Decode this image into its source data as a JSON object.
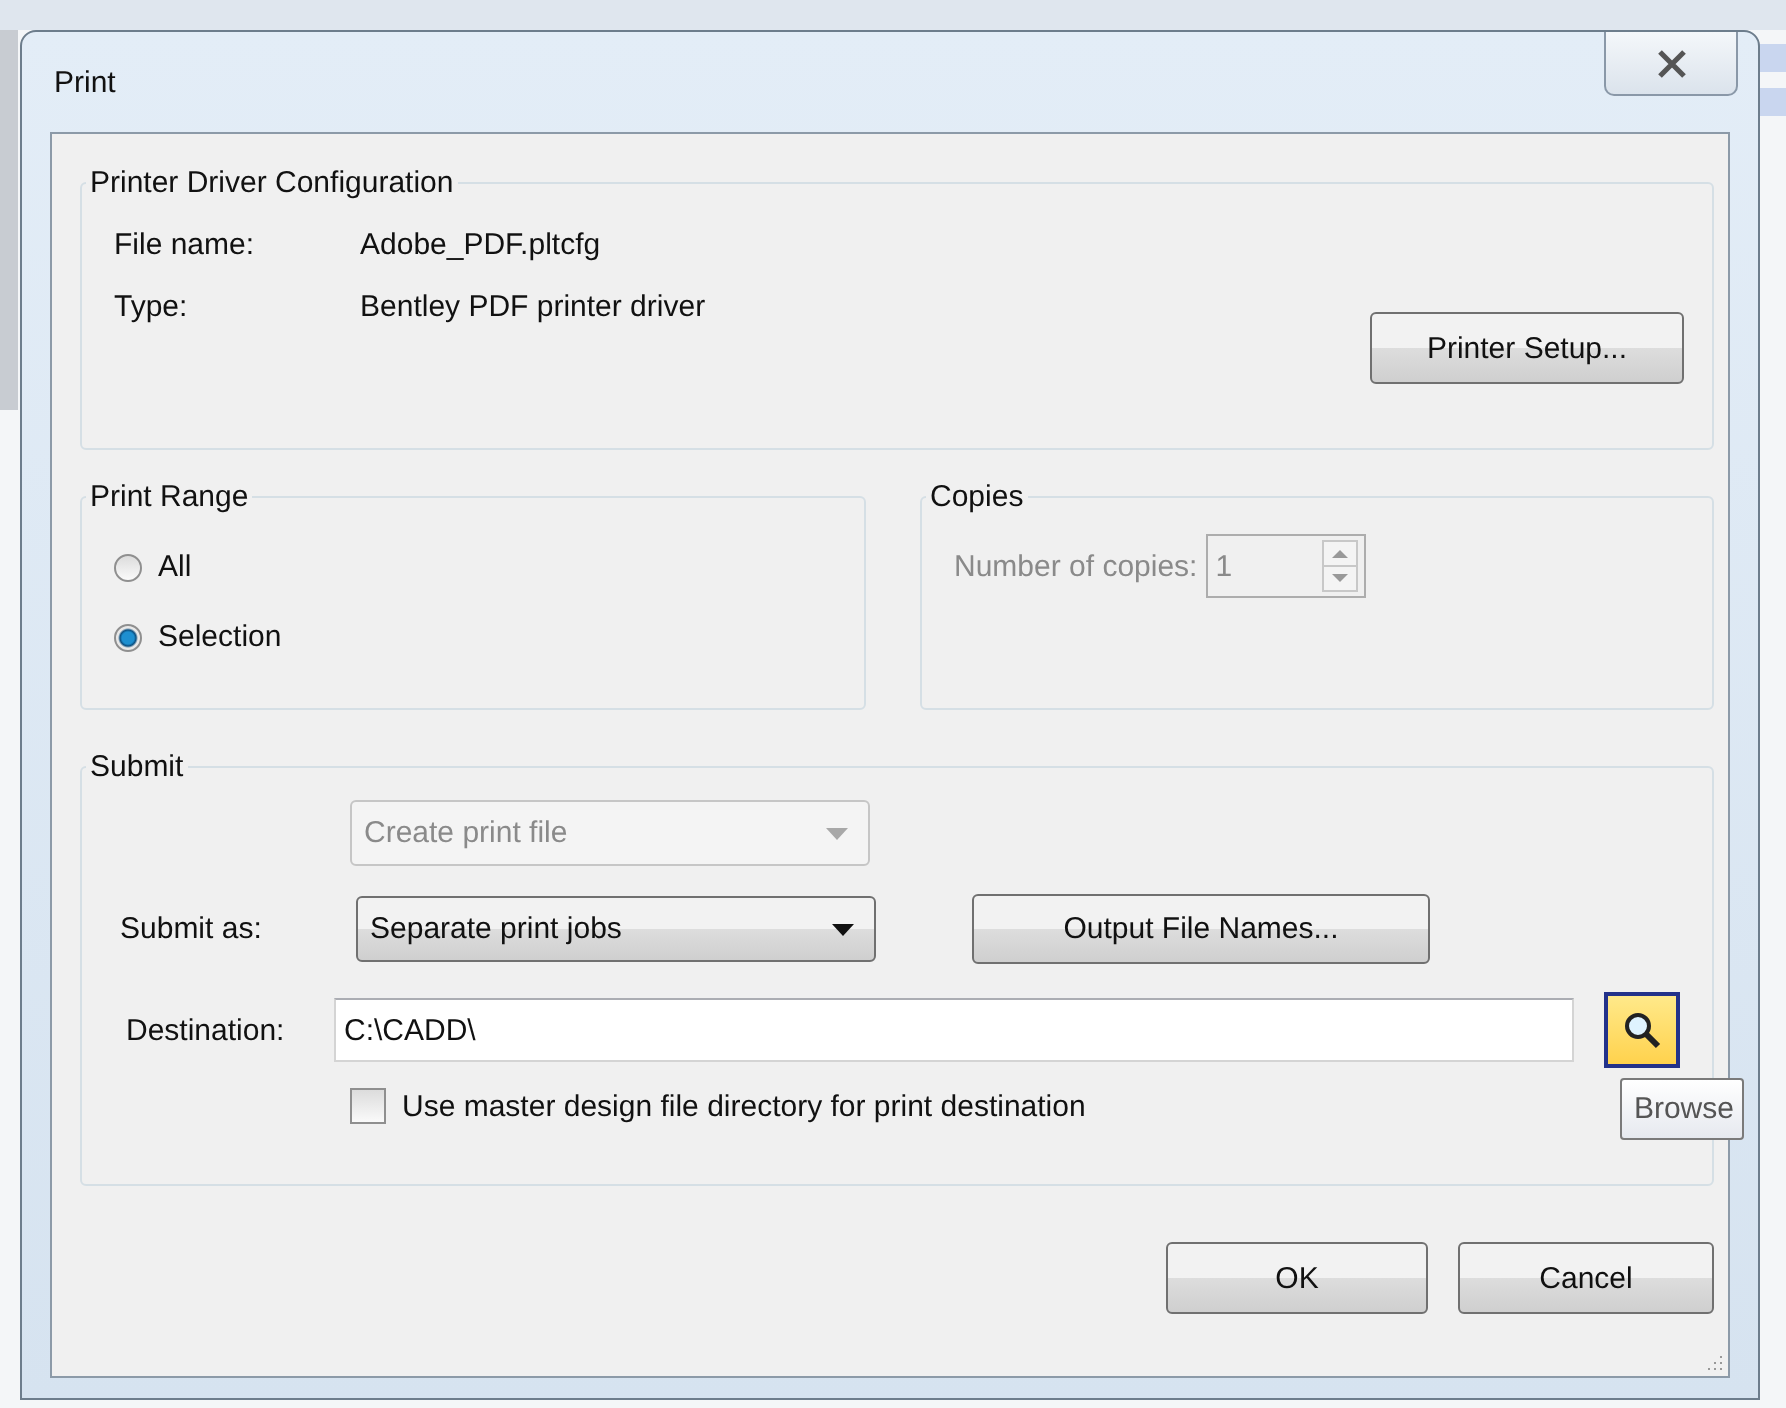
{
  "window": {
    "title": "Print"
  },
  "printer_driver": {
    "title": "Printer Driver Configuration",
    "fields": [
      {
        "label": "File name:",
        "value": "Adobe_PDF.pltcfg"
      },
      {
        "label": "Type:",
        "value": "Bentley PDF printer driver"
      }
    ],
    "setup_button": "Printer Setup..."
  },
  "print_range": {
    "title": "Print Range",
    "options": [
      {
        "label": "All",
        "selected": false
      },
      {
        "label": "Selection",
        "selected": true
      }
    ]
  },
  "copies": {
    "title": "Copies",
    "label": "Number of copies:",
    "value": "1",
    "disabled": true
  },
  "submit": {
    "title": "Submit",
    "print_file": {
      "value": "Create print file",
      "disabled": true
    },
    "submit_as": {
      "label": "Submit as:",
      "value": "Separate print jobs",
      "disabled": false
    },
    "output_button": "Output File Names...",
    "destination": {
      "label": "Destination:",
      "value": "C:\\CADD\\"
    },
    "browse": {
      "hovered": true,
      "tooltip": "Browse"
    },
    "use_master": {
      "label": "Use master design file directory for print destination",
      "checked": false
    }
  },
  "buttons": [
    "OK",
    "Cancel"
  ]
}
